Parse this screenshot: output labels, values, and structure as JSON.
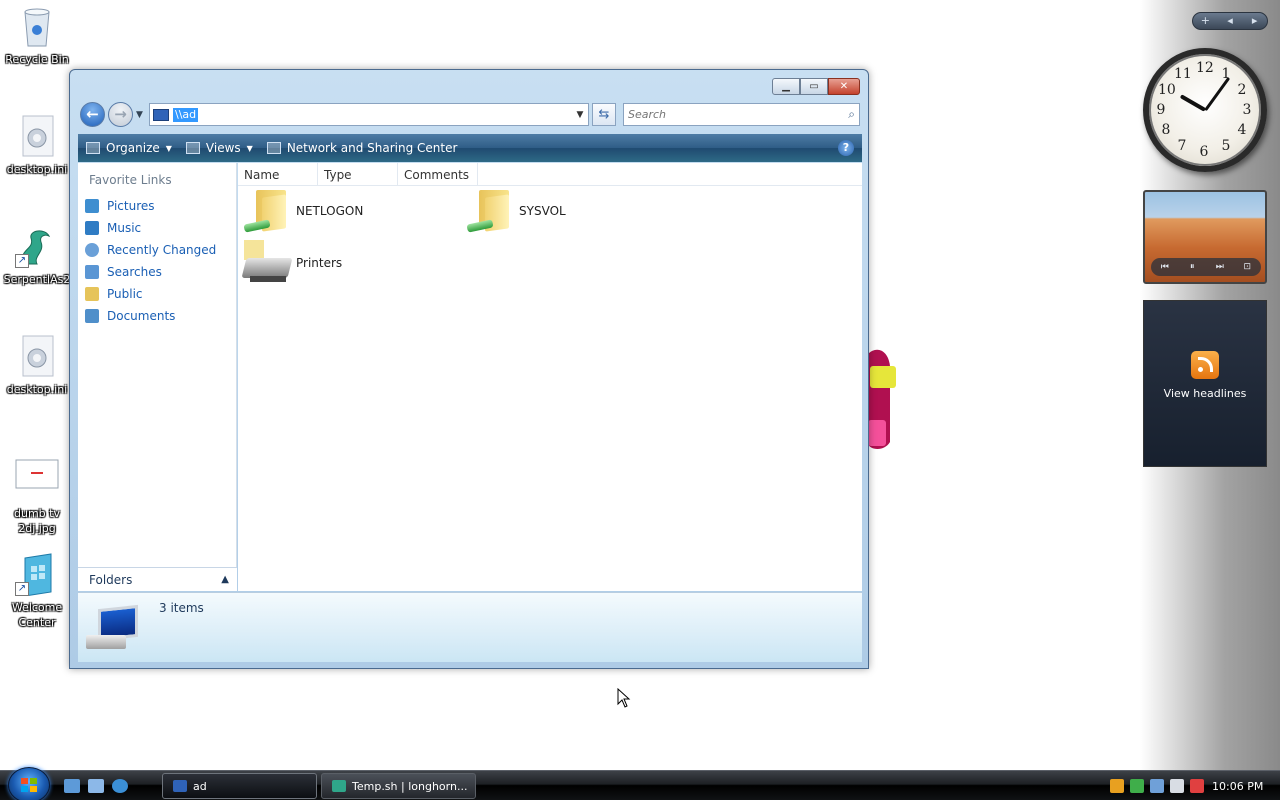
{
  "desktop_icons": [
    {
      "label": "Recycle Bin"
    },
    {
      "label": "desktop.ini"
    },
    {
      "label": "SerpentIAs2"
    },
    {
      "label": "desktop.ini"
    },
    {
      "label": "dumb tv 2dj.jpg"
    },
    {
      "label": "Welcome Center"
    }
  ],
  "sidebar": {
    "controls": [
      "+",
      "◂",
      "▸"
    ],
    "clock_numbers": [
      "12",
      "1",
      "2",
      "3",
      "4",
      "5",
      "6",
      "7",
      "8",
      "9",
      "10",
      "11"
    ],
    "feed_text": "View headlines"
  },
  "window": {
    "address": "\\\\ad",
    "search_placeholder": "Search",
    "toolbar": {
      "organize": "Organize",
      "views": "Views",
      "network": "Network and Sharing Center"
    },
    "nav": {
      "header": "Favorite Links",
      "links": [
        "Pictures",
        "Music",
        "Recently Changed",
        "Searches",
        "Public",
        "Documents"
      ],
      "folders": "Folders"
    },
    "columns": [
      "Name",
      "Type",
      "Comments"
    ],
    "items": [
      "NETLOGON",
      "SYSVOL",
      "Printers"
    ],
    "status": "3 items"
  },
  "taskbar": {
    "buttons": [
      "ad",
      "Temp.sh | longhorn..."
    ],
    "time": "10:06 PM"
  }
}
